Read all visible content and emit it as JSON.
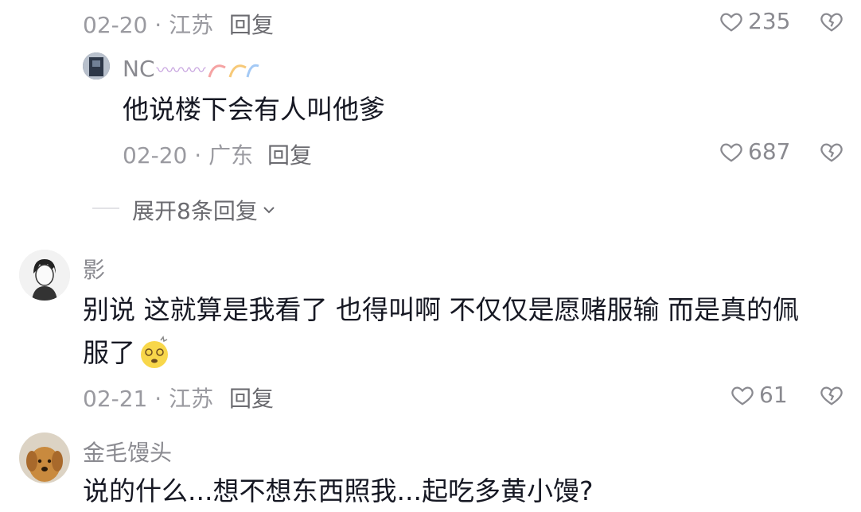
{
  "comment0": {
    "meta": "02-20 · 江苏",
    "reply_label": "回复",
    "likes": "235"
  },
  "reply1": {
    "username": "NC",
    "username_decor": "〰〰〰",
    "text": "他说楼下会有人叫他爹",
    "meta": "02-20 · 广东",
    "reply_label": "回复",
    "likes": "687"
  },
  "expand_label": "展开8条回复",
  "comment2": {
    "username": "影",
    "text_line1": "别说 这就算是我看了 也得叫啊 不仅仅是愿赌服输 而是真的佩",
    "text_line2": "服了",
    "meta": "02-21 · 江苏",
    "reply_label": "回复",
    "likes": "61"
  },
  "comment3": {
    "username": "金毛馒头",
    "text_partial": "说的什么...想不想东西照我...起吃多黄小馒?"
  },
  "colors": {
    "text": "#161823",
    "meta": "#9a9aa0",
    "action": "#6b6b70"
  }
}
